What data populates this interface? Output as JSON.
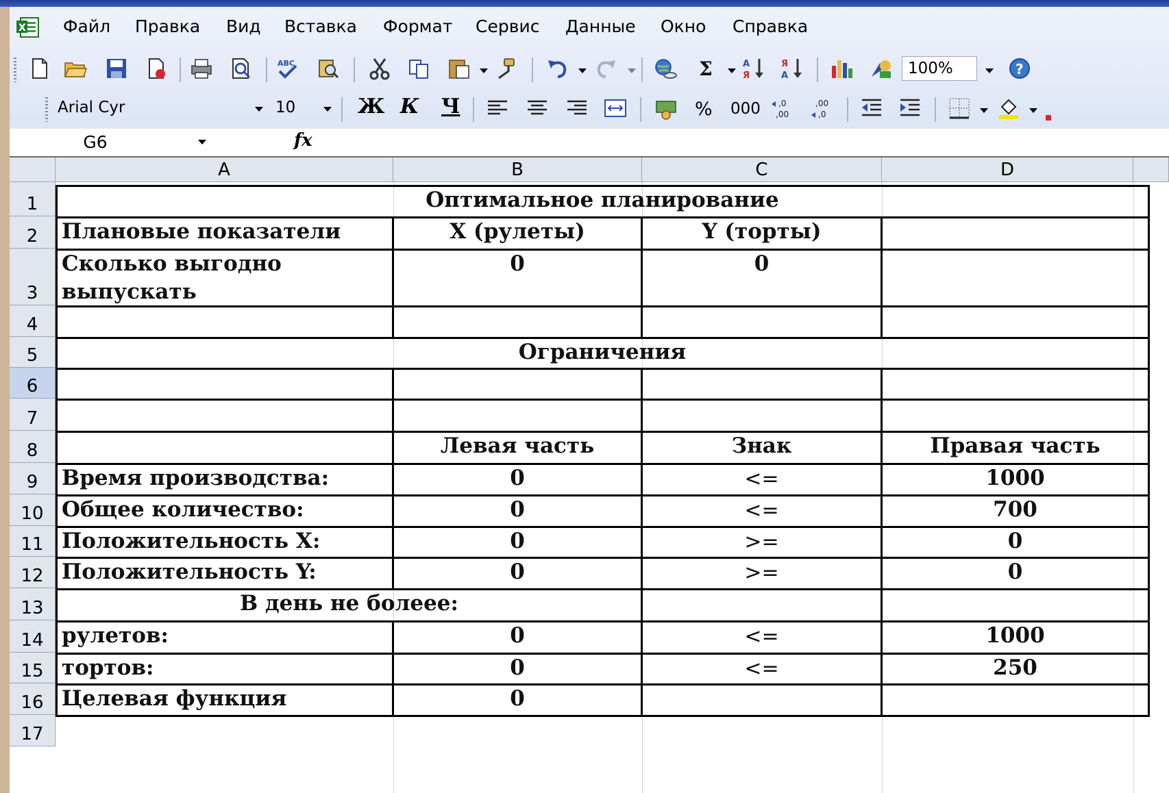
{
  "menu": {
    "items": [
      "Файл",
      "Правка",
      "Вид",
      "Вставка",
      "Формат",
      "Сервис",
      "Данные",
      "Окно",
      "Справка"
    ]
  },
  "standard_toolbar": {
    "zoom": "100%"
  },
  "formatting_toolbar": {
    "font": "Arial Cyr",
    "size": "10",
    "bold": "Ж",
    "italic": "К",
    "underline": "Ч",
    "percent": "%",
    "thousands": "000"
  },
  "formula_bar": {
    "name_box": "G6",
    "fx": "fx",
    "formula": ""
  },
  "sheet": {
    "columns": [
      "A",
      "B",
      "C",
      "D"
    ],
    "rows": [
      "1",
      "2",
      "3",
      "4",
      "5",
      "6",
      "7",
      "8",
      "9",
      "10",
      "11",
      "12",
      "13",
      "14",
      "15",
      "16",
      "17"
    ],
    "title": "Оптимальное планирование",
    "r2": {
      "a": "Плановые показатели",
      "b": "X (рулеты)",
      "c": "Y (торты)"
    },
    "r3": {
      "a1": "Сколько выгодно",
      "a2": "выпускать",
      "b": "0",
      "c": "0"
    },
    "r5": "Ограничения",
    "r8": {
      "b": "Левая часть",
      "c": "Знак",
      "d": "Правая часть"
    },
    "r9": {
      "a": "Время производства:",
      "b": "0",
      "c": "<=",
      "d": "1000"
    },
    "r10": {
      "a": "Общее количество:",
      "b": "0",
      "c": "<=",
      "d": "700"
    },
    "r11": {
      "a": "Положительность X:",
      "b": "0",
      "c": ">=",
      "d": "0"
    },
    "r12": {
      "a": "Положительность Y:",
      "b": "0",
      "c": ">=",
      "d": "0"
    },
    "r13": {
      "a": "В день  не болеее:"
    },
    "r14": {
      "a": "рулетов:",
      "b": "0",
      "c": "<=",
      "d": "1000"
    },
    "r15": {
      "a": "тортов:",
      "b": "0",
      "c": "<=",
      "d": "250"
    },
    "r16": {
      "a": "Целевая функция",
      "b": "0"
    }
  }
}
